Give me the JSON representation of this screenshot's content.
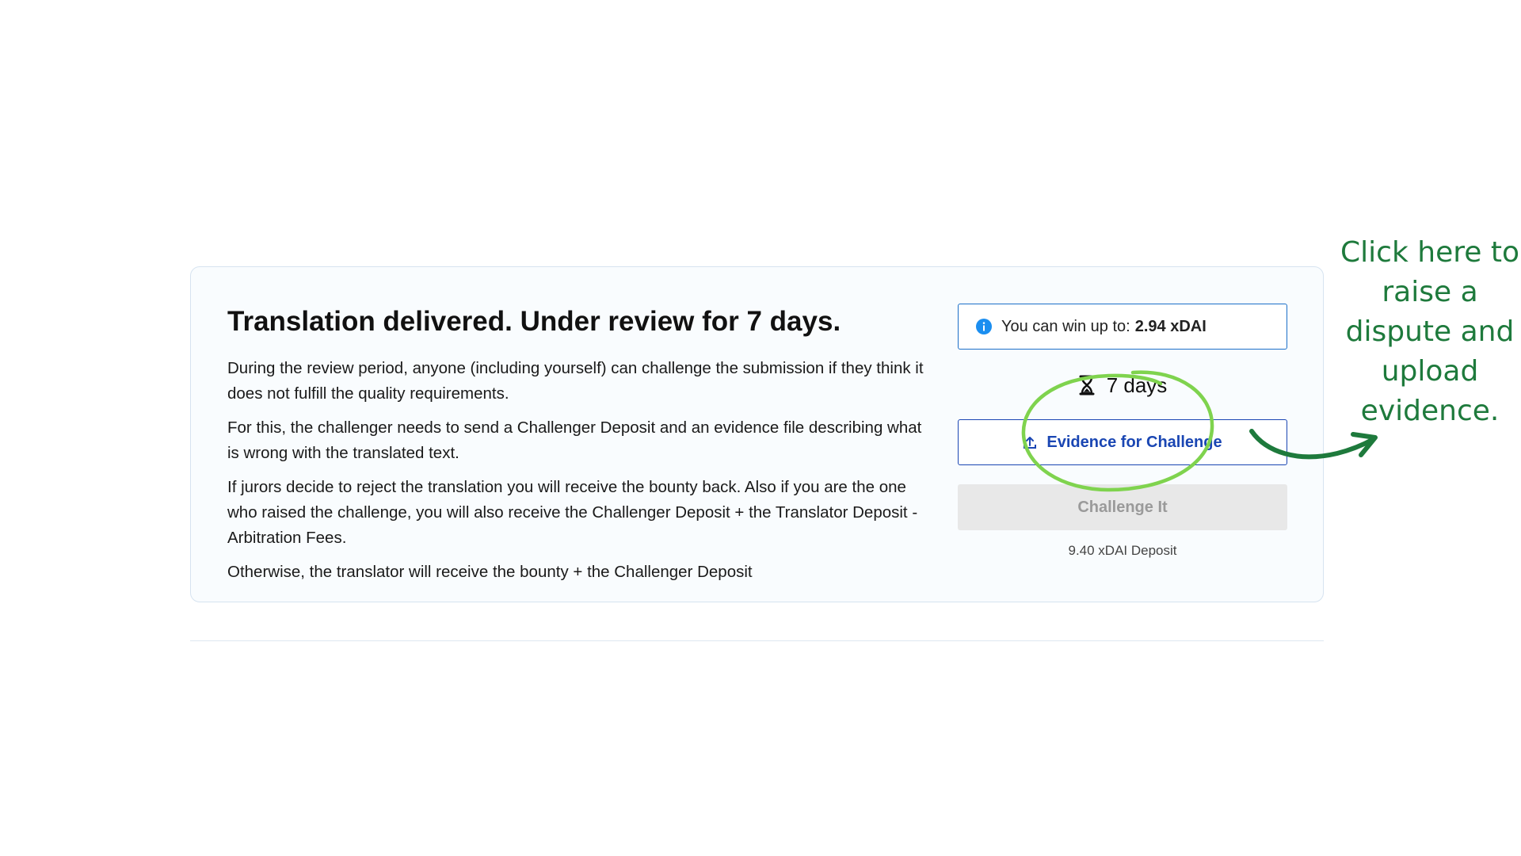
{
  "card": {
    "title": "Translation delivered. Under review for 7 days.",
    "paragraphs": [
      "During the review period, anyone (including yourself) can challenge the submission if they think it does not fulfill the quality requirements.",
      "For this, the challenger needs to send a Challenger Deposit and an evidence file describing what is wrong with the translated text.",
      "If jurors decide to reject the translation you will receive the bounty back. Also if you are the one who raised the challenge, you will also receive the Challenger Deposit + the Translator Deposit - Arbitration Fees.",
      "Otherwise, the translator will receive the bounty + the Challenger Deposit"
    ]
  },
  "sidebar": {
    "win_label": "You can win up to:",
    "win_value": "2.94 xDAI",
    "timer": "7 days",
    "evidence_button": "Evidence for Challenge",
    "challenge_button": "Challenge It",
    "deposit": "9.40 xDAI Deposit"
  },
  "annotation": {
    "text": "Click here to raise a dispute and upload evidence."
  },
  "colors": {
    "accent_blue": "#1b6fc8",
    "evidence_blue": "#1a46b3",
    "annotation_green": "#1e7a3c",
    "circle_green": "#7fd34e"
  },
  "icons": {
    "info": "info-icon",
    "timer": "hourglass-icon",
    "upload": "upload-icon"
  }
}
